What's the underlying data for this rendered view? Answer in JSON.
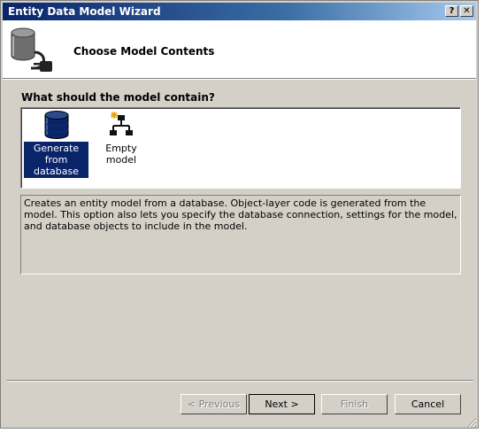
{
  "window": {
    "title": "Entity Data Model Wizard",
    "help_label": "?",
    "close_label": "✕"
  },
  "header": {
    "title": "Choose Model Contents",
    "icon": "database-plug-icon"
  },
  "question": "What should the model contain?",
  "options": [
    {
      "label": "Generate from database",
      "icon": "database-icon",
      "selected": true
    },
    {
      "label": "Empty model",
      "icon": "empty-model-icon",
      "selected": false
    }
  ],
  "description": "Creates an entity model from a database. Object-layer code is generated from the model. This option also lets you specify the database connection, settings for the model, and database objects to include in the model.",
  "buttons": {
    "previous": "< Previous",
    "next": "Next >",
    "finish": "Finish",
    "cancel": "Cancel"
  },
  "colors": {
    "selection": "#0a246a",
    "dialog_face": "#d4d0c8",
    "title_gradient_start": "#0a246a"
  }
}
